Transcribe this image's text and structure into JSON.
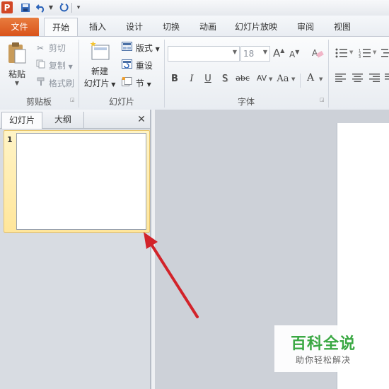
{
  "app": {
    "icon_letter": "P"
  },
  "quick_access": {
    "items": [
      "save-icon",
      "undo-icon",
      "redo-icon",
      "customize-icon"
    ]
  },
  "tabs": [
    "文件",
    "开始",
    "插入",
    "设计",
    "切换",
    "动画",
    "幻灯片放映",
    "审阅",
    "视图"
  ],
  "ribbon": {
    "clipboard": {
      "paste_label": "粘贴",
      "cut_label": "剪切",
      "copy_label": "复制",
      "format_painter_label": "格式刷",
      "group_label": "剪贴板"
    },
    "slides": {
      "new_slide_line1": "新建",
      "new_slide_line2": "幻灯片",
      "layout_label": "版式",
      "reset_label": "重设",
      "section_label": "节",
      "group_label": "幻灯片"
    },
    "font": {
      "font_name": "",
      "font_size": "18",
      "grow_label": "A",
      "shrink_label": "A",
      "bold": "B",
      "italic": "I",
      "underline": "U",
      "shadow": "S",
      "strike": "abc",
      "spacing": "AV",
      "case": "Aa",
      "color": "A",
      "group_label": "字体"
    }
  },
  "panel": {
    "tab_slides": "幻灯片",
    "tab_outline": "大纲",
    "close_glyph": "✕",
    "slide_number": "1"
  },
  "watermark": {
    "title": "百科全说",
    "subtitle": "助你轻松解决"
  },
  "colors": {
    "file_tab": "#d9541b",
    "selection": "#ffe69b",
    "arrow": "#d2232a",
    "watermark_green": "#3aa843"
  }
}
